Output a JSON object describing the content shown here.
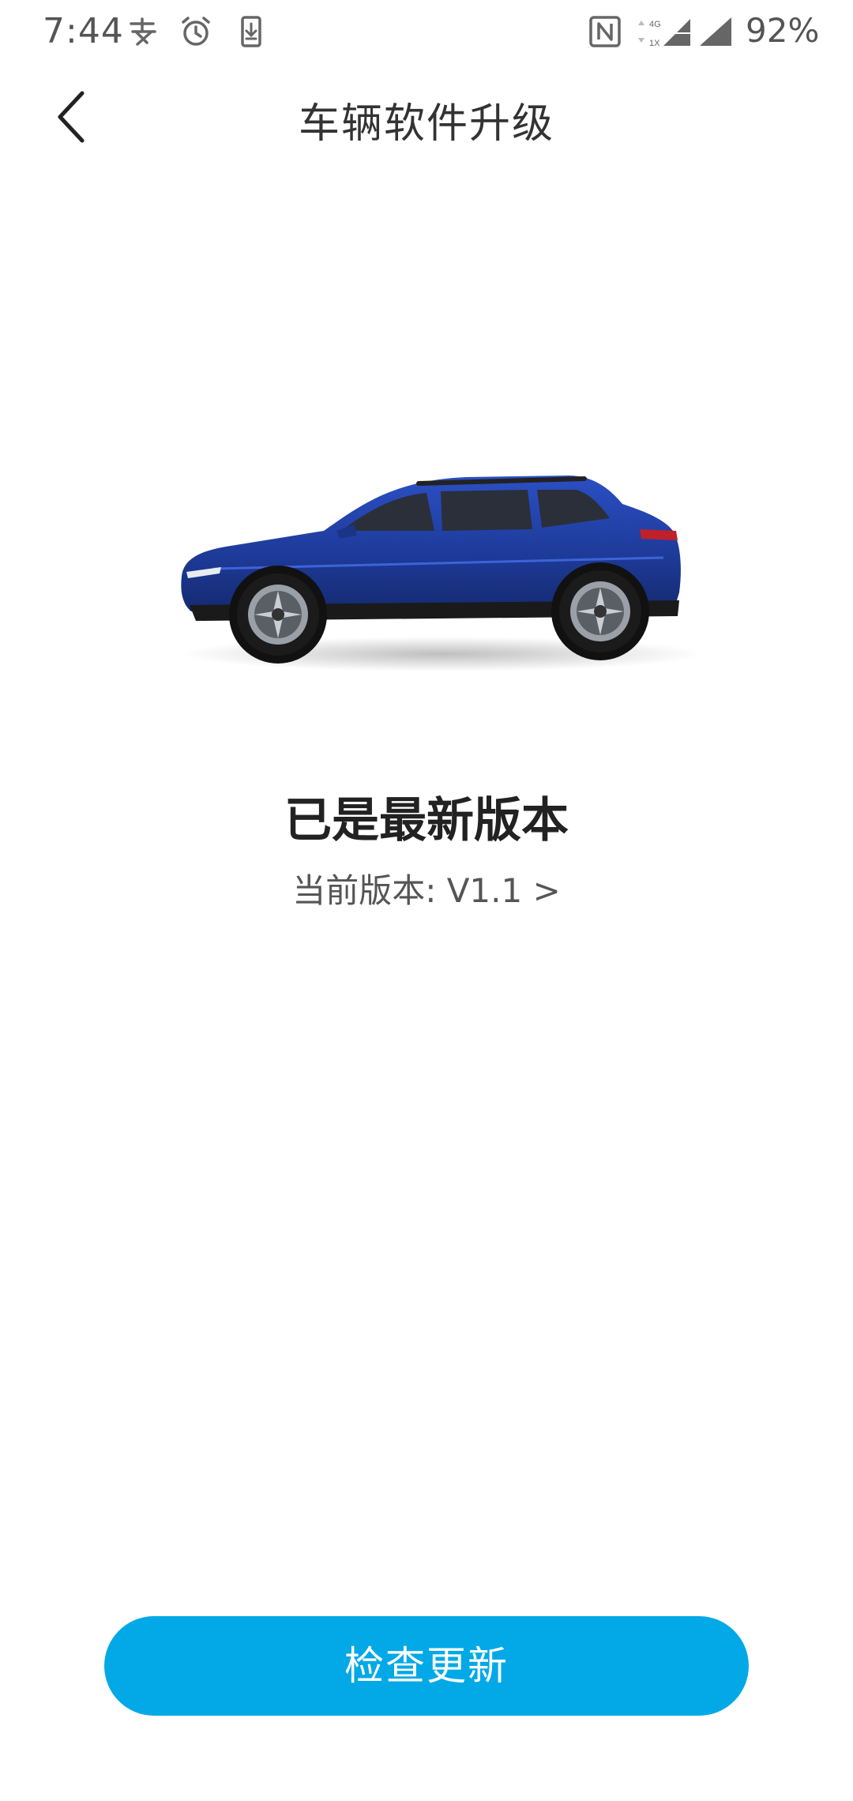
{
  "status_bar": {
    "time": "7:44",
    "battery": "92%",
    "icons": [
      "alipay-icon",
      "alarm-icon",
      "download-icon",
      "nfc-icon",
      "signal-4g-icon",
      "signal-icon"
    ]
  },
  "header": {
    "back_icon": "chevron-left-icon",
    "title": "车辆软件升级"
  },
  "main": {
    "car_image": "blue-suv-side-view",
    "status_title": "已是最新版本",
    "version_label": "当前版本: V1.1 >"
  },
  "footer": {
    "check_button_label": "检查更新"
  },
  "colors": {
    "accent": "#03a9e6",
    "car_body": "#1f3c9c",
    "text_primary": "#222222",
    "text_secondary": "#555555"
  }
}
